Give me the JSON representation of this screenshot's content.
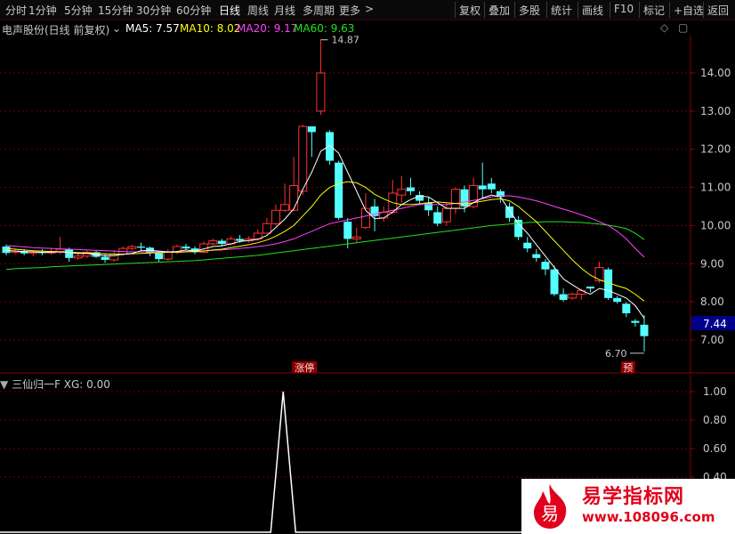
{
  "toolbar": {
    "periods": [
      {
        "label": "分时",
        "active": false
      },
      {
        "label": "1分钟",
        "active": false
      },
      {
        "label": "5分钟",
        "active": false
      },
      {
        "label": "15分钟",
        "active": false
      },
      {
        "label": "30分钟",
        "active": false
      },
      {
        "label": "60分钟",
        "active": false
      },
      {
        "label": "日线",
        "active": true
      },
      {
        "label": "周线",
        "active": false
      },
      {
        "label": "月线",
        "active": false
      },
      {
        "label": "多周期",
        "active": false
      },
      {
        "label": "更多",
        "active": false
      }
    ],
    "more_arrow": ">",
    "actions": [
      "复权",
      "叠加",
      "多股",
      "统计",
      "画线",
      "F10",
      "标记",
      "+自选",
      "返回"
    ]
  },
  "infobar": {
    "stock_title": "电声股份(日线 前复权)",
    "ma5": "MA5: 7.57",
    "ma10": "MA10: 8.02",
    "ma20": "MA20: 9.17",
    "ma60": "MA60: 9.63",
    "colors": {
      "ma5": "#ffffff",
      "ma10": "#ffff00",
      "ma20": "#ff40ff",
      "ma60": "#20e020"
    }
  },
  "price_axis": {
    "ticks": [
      "14.00",
      "13.00",
      "12.00",
      "11.00",
      "10.00",
      "9.00",
      "8.00",
      "7.00"
    ],
    "current_price": "7.44"
  },
  "annotations": {
    "high": "14.87",
    "low": "6.70",
    "limit_up_tag": "涨停",
    "forecast_tag": "预"
  },
  "indicator": {
    "title": "三仙归一F  XG: 0.00",
    "ticks": [
      "1.00",
      "0.80",
      "0.60",
      "0.40"
    ]
  },
  "watermark": {
    "logo_char": "易",
    "name": "易学指标网",
    "url": "www.108096.com"
  },
  "chart_data": {
    "type": "candlestick",
    "ylim": [
      6.5,
      14.9
    ],
    "candles": [
      [
        9.45,
        9.28,
        9.5,
        9.22
      ],
      [
        9.3,
        9.33,
        9.4,
        9.25
      ],
      [
        9.33,
        9.27,
        9.38,
        9.22
      ],
      [
        9.27,
        9.3,
        9.35,
        9.2
      ],
      [
        9.3,
        9.28,
        9.38,
        9.22
      ],
      [
        9.28,
        9.32,
        9.4,
        9.24
      ],
      [
        9.32,
        9.38,
        9.7,
        9.25
      ],
      [
        9.38,
        9.15,
        9.42,
        9.05
      ],
      [
        9.15,
        9.2,
        9.3,
        9.1
      ],
      [
        9.2,
        9.3,
        9.35,
        9.15
      ],
      [
        9.3,
        9.18,
        9.34,
        9.15
      ],
      [
        9.18,
        9.1,
        9.25,
        9.02
      ],
      [
        9.1,
        9.25,
        9.35,
        9.05
      ],
      [
        9.25,
        9.4,
        9.45,
        9.2
      ],
      [
        9.4,
        9.45,
        9.5,
        9.35
      ],
      [
        9.45,
        9.42,
        9.55,
        9.35
      ],
      [
        9.42,
        9.28,
        9.45,
        9.2
      ],
      [
        9.28,
        9.12,
        9.32,
        9.05
      ],
      [
        9.12,
        9.3,
        9.38,
        9.08
      ],
      [
        9.3,
        9.45,
        9.5,
        9.25
      ],
      [
        9.45,
        9.4,
        9.52,
        9.35
      ],
      [
        9.4,
        9.3,
        9.45,
        9.25
      ],
      [
        9.3,
        9.52,
        9.58,
        9.28
      ],
      [
        9.52,
        9.6,
        9.66,
        9.48
      ],
      [
        9.6,
        9.52,
        9.65,
        9.45
      ],
      [
        9.52,
        9.65,
        9.72,
        9.48
      ],
      [
        9.65,
        9.6,
        9.75,
        9.55
      ],
      [
        9.6,
        9.65,
        9.72,
        9.55
      ],
      [
        9.65,
        9.8,
        9.9,
        9.6
      ],
      [
        9.8,
        10.05,
        10.2,
        9.78
      ],
      [
        10.05,
        10.4,
        10.55,
        10.0
      ],
      [
        10.4,
        10.55,
        11.1,
        10.35
      ],
      [
        10.4,
        11.05,
        11.8,
        10.38
      ],
      [
        10.9,
        12.6,
        12.65,
        10.8
      ],
      [
        12.6,
        12.45,
        12.6,
        11.8
      ],
      [
        13.0,
        14.0,
        14.87,
        12.9
      ],
      [
        12.45,
        11.7,
        12.5,
        11.6
      ],
      [
        11.65,
        10.2,
        11.7,
        10.15
      ],
      [
        10.1,
        9.65,
        10.2,
        9.4
      ],
      [
        9.65,
        9.7,
        9.95,
        9.55
      ],
      [
        9.95,
        10.45,
        10.85,
        9.9
      ],
      [
        10.5,
        10.25,
        10.7,
        9.85
      ],
      [
        10.2,
        10.35,
        10.5,
        10.1
      ],
      [
        10.35,
        10.85,
        11.2,
        10.3
      ],
      [
        10.8,
        10.95,
        11.3,
        10.6
      ],
      [
        11.0,
        10.9,
        11.25,
        10.8
      ],
      [
        10.8,
        10.65,
        10.9,
        10.55
      ],
      [
        10.6,
        10.4,
        10.75,
        10.25
      ],
      [
        10.35,
        10.05,
        10.5,
        9.98
      ],
      [
        10.1,
        10.45,
        10.6,
        10.0
      ],
      [
        10.45,
        10.95,
        11.0,
        10.3
      ],
      [
        10.95,
        10.5,
        11.05,
        10.35
      ],
      [
        10.5,
        11.05,
        11.25,
        10.45
      ],
      [
        11.05,
        10.95,
        11.65,
        10.7
      ],
      [
        11.1,
        10.95,
        11.25,
        10.85
      ],
      [
        10.9,
        10.75,
        10.95,
        10.6
      ],
      [
        10.5,
        10.2,
        10.6,
        10.1
      ],
      [
        10.15,
        9.7,
        10.25,
        9.62
      ],
      [
        9.55,
        9.4,
        9.7,
        9.3
      ],
      [
        9.25,
        9.15,
        9.38,
        9.05
      ],
      [
        9.05,
        8.85,
        9.12,
        8.7
      ],
      [
        8.85,
        8.2,
        8.95,
        8.15
      ],
      [
        8.2,
        8.05,
        8.35,
        8.0
      ],
      [
        8.1,
        8.2,
        8.25,
        8.05
      ],
      [
        8.2,
        8.3,
        8.35,
        8.05
      ],
      [
        8.4,
        8.35,
        8.4,
        8.25
      ],
      [
        8.55,
        8.9,
        9.05,
        8.5
      ],
      [
        8.85,
        8.1,
        8.9,
        8.05
      ],
      [
        8.1,
        8.0,
        8.15,
        7.95
      ],
      [
        7.95,
        7.7,
        8.0,
        7.6
      ],
      [
        7.5,
        7.45,
        7.55,
        7.35
      ],
      [
        7.4,
        7.1,
        7.65,
        6.7
      ]
    ],
    "ma5": [
      9.35,
      9.33,
      9.32,
      9.31,
      9.3,
      9.3,
      9.31,
      9.29,
      9.27,
      9.27,
      9.24,
      9.21,
      9.21,
      9.25,
      9.27,
      9.34,
      9.35,
      9.33,
      9.31,
      9.32,
      9.36,
      9.33,
      9.39,
      9.45,
      9.47,
      9.52,
      9.58,
      9.61,
      9.64,
      9.74,
      9.95,
      10.17,
      10.44,
      10.95,
      11.4,
      11.95,
      12.1,
      11.9,
      11.4,
      10.9,
      10.4,
      10.18,
      10.2,
      10.35,
      10.55,
      10.68,
      10.78,
      10.75,
      10.6,
      10.45,
      10.45,
      10.45,
      10.6,
      10.72,
      10.8,
      10.75,
      10.4,
      10.05,
      9.8,
      9.5,
      9.2,
      8.9,
      8.6,
      8.45,
      8.3,
      8.2,
      8.35,
      8.3,
      8.2,
      8.1,
      7.9,
      7.57
    ],
    "ma10": [
      9.4,
      9.38,
      9.36,
      9.34,
      9.33,
      9.32,
      9.31,
      9.3,
      9.29,
      9.28,
      9.27,
      9.26,
      9.25,
      9.25,
      9.26,
      9.27,
      9.28,
      9.29,
      9.3,
      9.3,
      9.31,
      9.32,
      9.33,
      9.36,
      9.38,
      9.42,
      9.46,
      9.5,
      9.55,
      9.62,
      9.72,
      9.85,
      10.0,
      10.25,
      10.5,
      10.8,
      11.0,
      11.1,
      11.15,
      11.12,
      11.0,
      10.82,
      10.7,
      10.6,
      10.55,
      10.55,
      10.57,
      10.6,
      10.62,
      10.6,
      10.58,
      10.56,
      10.6,
      10.64,
      10.68,
      10.7,
      10.65,
      10.5,
      10.3,
      10.1,
      9.85,
      9.6,
      9.35,
      9.1,
      8.88,
      8.7,
      8.58,
      8.5,
      8.42,
      8.35,
      8.2,
      8.02
    ],
    "ma20": [
      9.48,
      9.46,
      9.44,
      9.42,
      9.41,
      9.4,
      9.39,
      9.38,
      9.37,
      9.36,
      9.35,
      9.34,
      9.33,
      9.32,
      9.31,
      9.31,
      9.31,
      9.31,
      9.31,
      9.31,
      9.32,
      9.33,
      9.34,
      9.35,
      9.36,
      9.38,
      9.4,
      9.42,
      9.45,
      9.48,
      9.52,
      9.58,
      9.65,
      9.75,
      9.85,
      9.95,
      10.05,
      10.1,
      10.15,
      10.2,
      10.25,
      10.3,
      10.35,
      10.4,
      10.45,
      10.5,
      10.55,
      10.55,
      10.55,
      10.55,
      10.58,
      10.62,
      10.66,
      10.7,
      10.75,
      10.78,
      10.78,
      10.75,
      10.7,
      10.65,
      10.58,
      10.5,
      10.43,
      10.36,
      10.28,
      10.2,
      10.1,
      10.0,
      9.85,
      9.65,
      9.4,
      9.17
    ],
    "ma60": [
      8.85,
      8.87,
      8.88,
      8.89,
      8.9,
      8.92,
      8.93,
      8.94,
      8.95,
      8.96,
      8.97,
      8.98,
      8.99,
      9.0,
      9.01,
      9.02,
      9.03,
      9.04,
      9.05,
      9.06,
      9.07,
      9.08,
      9.1,
      9.12,
      9.14,
      9.16,
      9.18,
      9.2,
      9.22,
      9.25,
      9.28,
      9.31,
      9.34,
      9.37,
      9.4,
      9.43,
      9.46,
      9.49,
      9.52,
      9.55,
      9.58,
      9.61,
      9.64,
      9.67,
      9.7,
      9.73,
      9.76,
      9.79,
      9.82,
      9.85,
      9.88,
      9.91,
      9.94,
      9.97,
      10.0,
      10.02,
      10.04,
      10.06,
      10.08,
      10.09,
      10.1,
      10.1,
      10.1,
      10.09,
      10.08,
      10.06,
      10.04,
      10.01,
      9.97,
      9.92,
      9.8,
      9.63
    ],
    "indicator_signal_index": 33,
    "limit_up_index": 33
  }
}
